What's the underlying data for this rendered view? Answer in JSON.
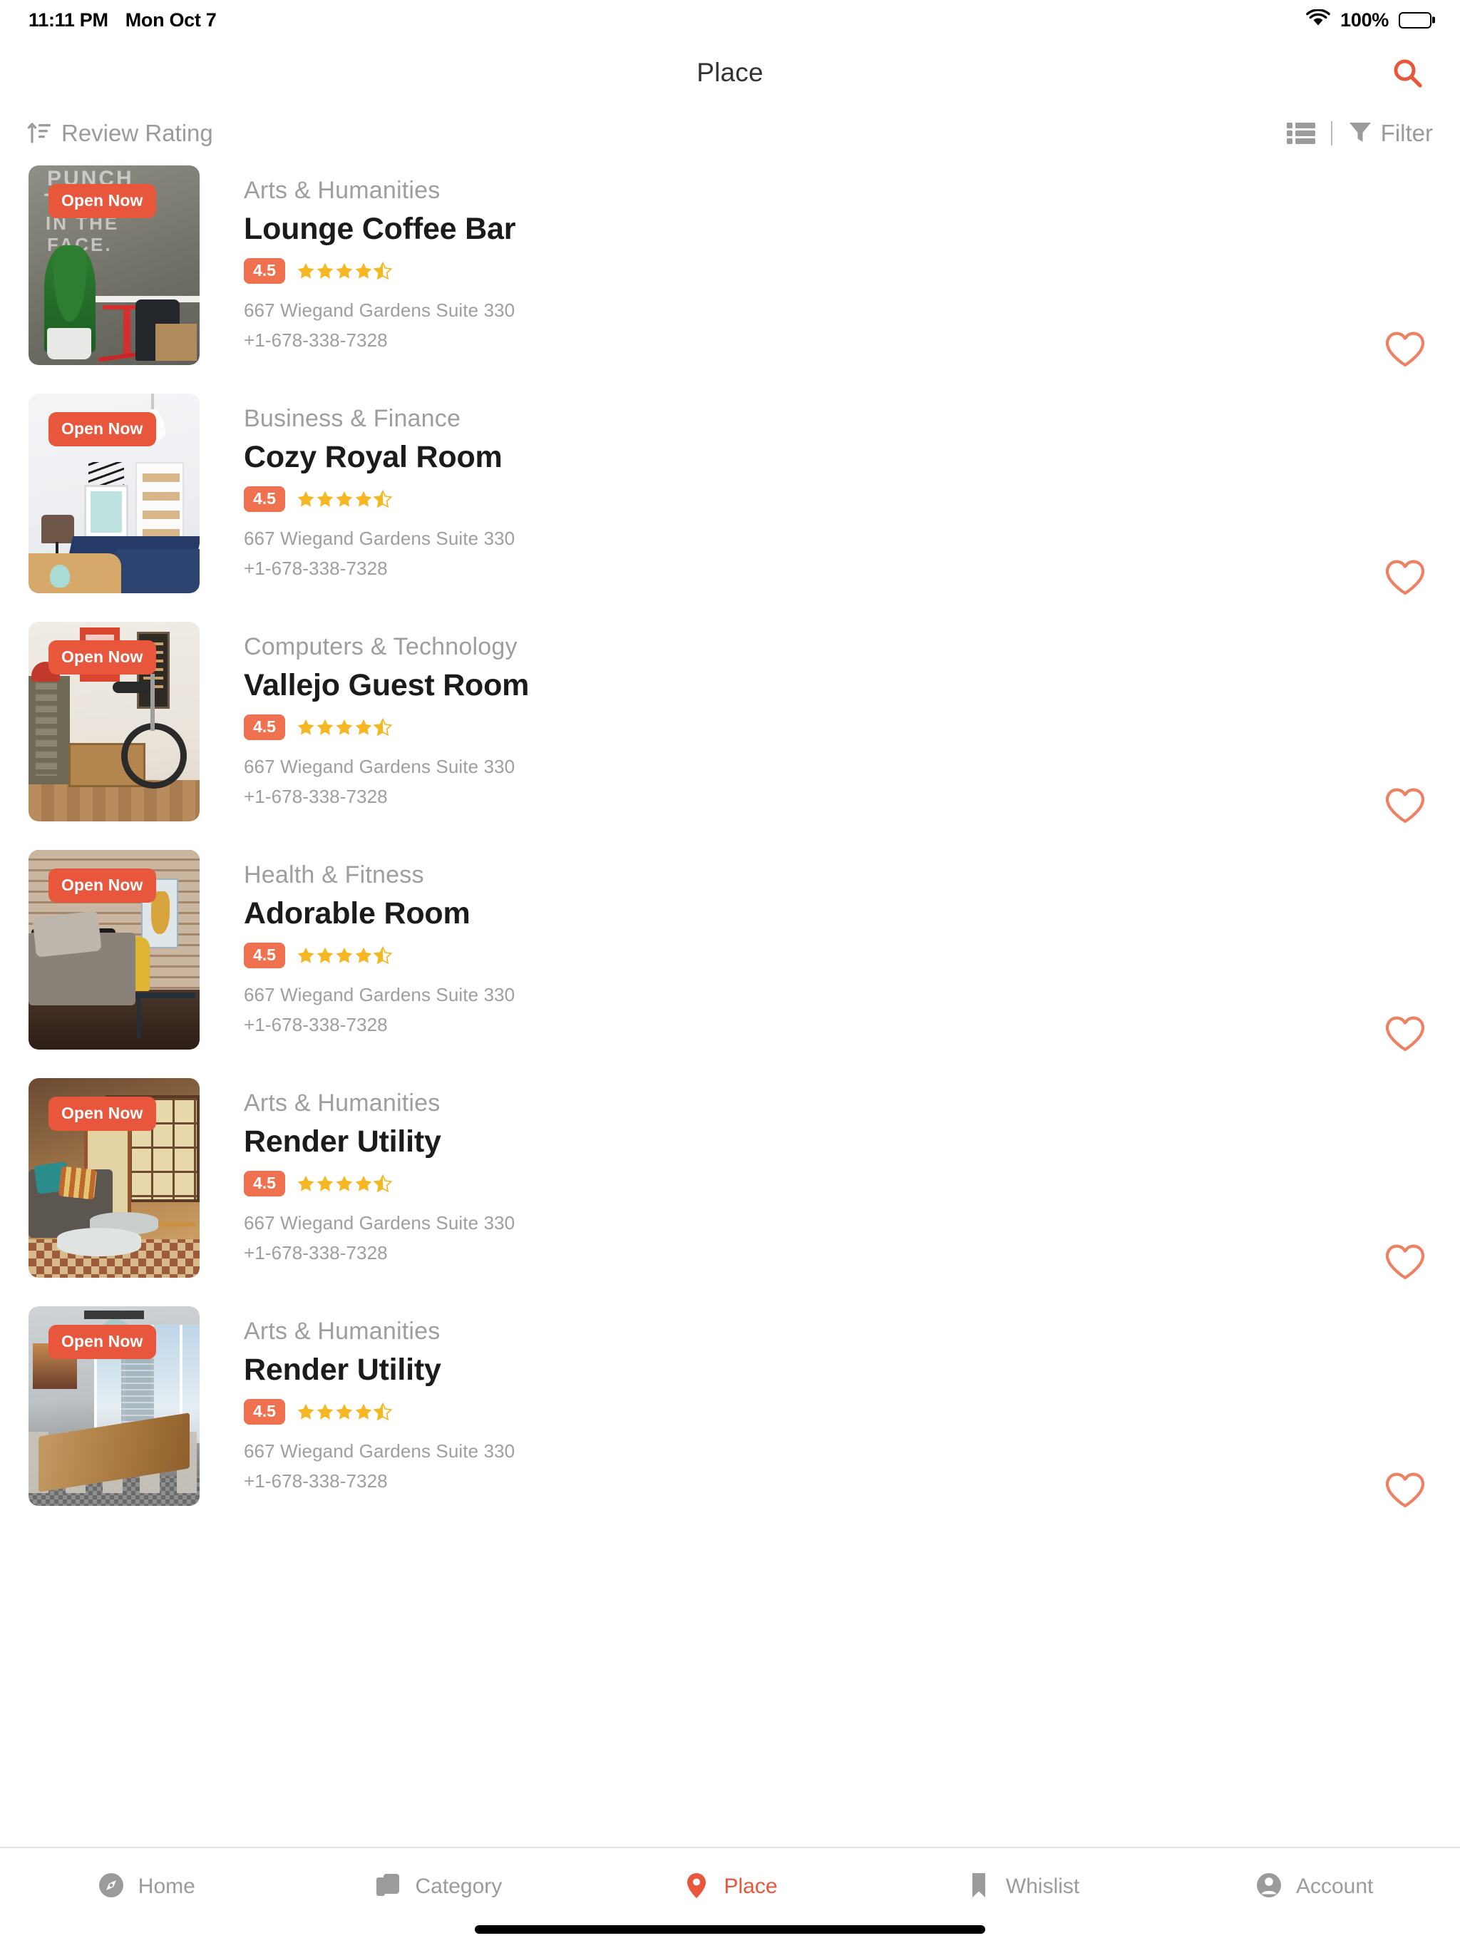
{
  "status_bar": {
    "time": "11:11 PM",
    "date": "Mon Oct 7",
    "battery_percent": "100%",
    "wifi_icon": "wifi-icon",
    "battery_icon": "battery-full-icon"
  },
  "nav": {
    "title": "Place",
    "search_icon": "search-icon"
  },
  "toolbar": {
    "sort_icon": "sort-ascending-icon",
    "sort_label": "Review Rating",
    "view_icon": "list-view-icon",
    "filter_icon": "funnel-icon",
    "filter_label": "Filter"
  },
  "colors": {
    "accent": "#E8563C",
    "rating_badge": "#F0714F",
    "star": "#F5B722",
    "muted_text": "#9e9e9e",
    "title_text": "#1b1b1b"
  },
  "places": [
    {
      "badge": "Open Now",
      "category": "Arts & Humanities",
      "name": "Lounge Coffee Bar",
      "rating": "4.5",
      "stars_full": 4,
      "stars_half": 1,
      "address": "667 Wiegand Gardens Suite 330",
      "phone": "+1-678-338-7328",
      "favorite_icon": "heart-outline-icon",
      "scene": "s1"
    },
    {
      "badge": "Open Now",
      "category": "Business & Finance",
      "name": "Cozy Royal Room",
      "rating": "4.5",
      "stars_full": 4,
      "stars_half": 1,
      "address": "667 Wiegand Gardens Suite 330",
      "phone": "+1-678-338-7328",
      "favorite_icon": "heart-outline-icon",
      "scene": "s2"
    },
    {
      "badge": "Open Now",
      "category": "Computers & Technology",
      "name": "Vallejo Guest Room",
      "rating": "4.5",
      "stars_full": 4,
      "stars_half": 1,
      "address": "667 Wiegand Gardens Suite 330",
      "phone": "+1-678-338-7328",
      "favorite_icon": "heart-outline-icon",
      "scene": "s3"
    },
    {
      "badge": "Open Now",
      "category": "Health & Fitness",
      "name": "Adorable Room",
      "rating": "4.5",
      "stars_full": 4,
      "stars_half": 1,
      "address": "667 Wiegand Gardens Suite 330",
      "phone": "+1-678-338-7328",
      "favorite_icon": "heart-outline-icon",
      "scene": "s4"
    },
    {
      "badge": "Open Now",
      "category": "Arts & Humanities",
      "name": "Render Utility",
      "rating": "4.5",
      "stars_full": 4,
      "stars_half": 1,
      "address": "667 Wiegand Gardens Suite 330",
      "phone": "+1-678-338-7328",
      "favorite_icon": "heart-outline-icon",
      "scene": "s5"
    },
    {
      "badge": "Open Now",
      "category": "Arts & Humanities",
      "name": "Render Utility",
      "rating": "4.5",
      "stars_full": 4,
      "stars_half": 1,
      "address": "667 Wiegand Gardens Suite 330",
      "phone": "+1-678-338-7328",
      "favorite_icon": "heart-outline-icon",
      "scene": "s6"
    }
  ],
  "tab_bar": {
    "items": [
      {
        "label": "Home",
        "icon": "compass-icon",
        "active": false
      },
      {
        "label": "Category",
        "icon": "cards-icon",
        "active": false
      },
      {
        "label": "Place",
        "icon": "map-pin-icon",
        "active": true
      },
      {
        "label": "Whislist",
        "icon": "bookmark-icon",
        "active": false
      },
      {
        "label": "Account",
        "icon": "account-icon",
        "active": false
      }
    ]
  }
}
